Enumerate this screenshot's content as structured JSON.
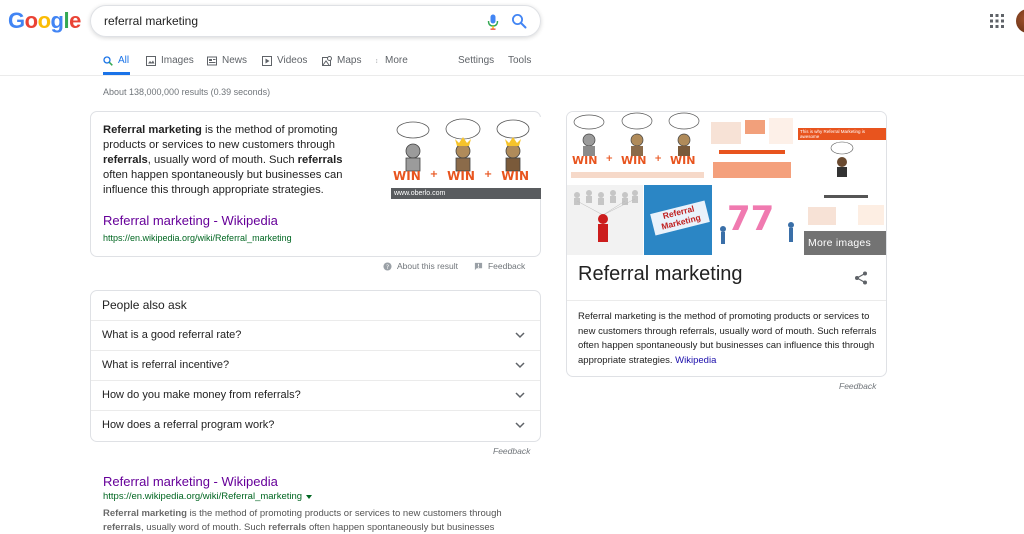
{
  "logo": {
    "letters": [
      "G",
      "o",
      "o",
      "g",
      "l",
      "e"
    ],
    "colors": [
      "#4285F4",
      "#EA4335",
      "#FBBC05",
      "#4285F4",
      "#34A853",
      "#EA4335"
    ]
  },
  "search": {
    "query": "referral marketing"
  },
  "tabs": [
    {
      "label": "All",
      "icon": "search-icon"
    },
    {
      "label": "Images",
      "icon": "image-icon"
    },
    {
      "label": "News",
      "icon": "newspaper-icon"
    },
    {
      "label": "Videos",
      "icon": "play-icon"
    },
    {
      "label": "Maps",
      "icon": "map-icon"
    },
    {
      "label": "More",
      "icon": "more-vert-icon"
    },
    {
      "label": "Settings"
    },
    {
      "label": "Tools"
    }
  ],
  "results_count": "About 138,000,000 results (0.39 seconds)",
  "snippet": {
    "p1_bold": "Referral marketing",
    "p1_rest": " is the method of promoting products or services to new customers through ",
    "p2_bold": "referrals",
    "p2_rest": ", usually word of mouth. Such ",
    "p3_bold": "referrals",
    "p3_rest": " often happen spontaneously but businesses can influence this through appropriate strategies.",
    "image_caption": "www.oberlo.com",
    "win_text": [
      "WIN",
      "+",
      "WIN",
      "+",
      "WIN"
    ],
    "link_title": "Referral marketing - Wikipedia",
    "link_url": "https://en.wikipedia.org/wiki/Referral_marketing",
    "about": "About this result",
    "feedback": "Feedback"
  },
  "paa": {
    "title": "People also ask",
    "questions": [
      "What is a good referral rate?",
      "What is referral incentive?",
      "How do you make money from referrals?",
      "How does a referral program work?"
    ],
    "feedback": "Feedback"
  },
  "organic": {
    "title": "Referral marketing - Wikipedia",
    "url": "https://en.wikipedia.org/wiki/Referral_marketing",
    "d1_bold": "Referral marketing",
    "d1_rest": " is the method of promoting products or services to new customers through ",
    "d2_bold": "referrals",
    "d2_rest": ", usually word of mouth. Such ",
    "d3_bold": "referrals",
    "d3_rest": " often happen spontaneously but businesses can"
  },
  "knowledge_panel": {
    "more_images": "More images",
    "title": "Referral marketing",
    "description": "Referral marketing is the method of promoting products or services to new customers through referrals, usually word of mouth. Such referrals often happen spontaneously but businesses can influence this through appropriate strategies. ",
    "source": "Wikipedia",
    "feedback": "Feedback",
    "tile_texts": {
      "win": [
        "WIN",
        "+",
        "WIN",
        "+",
        "WIN"
      ],
      "referral": "Referral Marketing",
      "big_number": "77",
      "awesome": "This is why Referral Marketing is awesome"
    }
  }
}
